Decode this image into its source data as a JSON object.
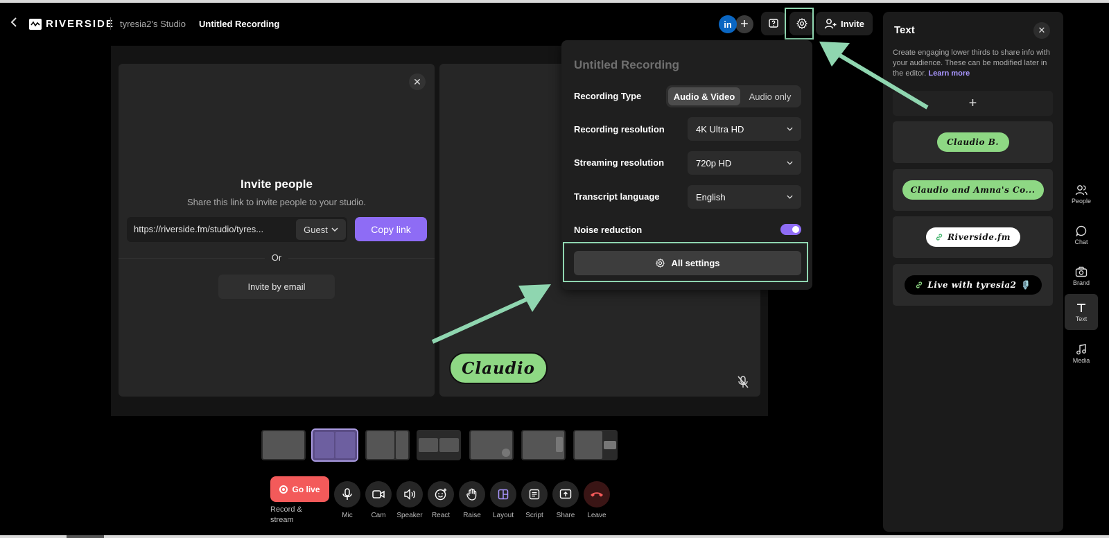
{
  "header": {
    "brand": "RIVERSIDE",
    "studio": "tyresia2's Studio",
    "recording_title": "Untitled Recording",
    "linkedin_badge": "in",
    "invite_label": "Invite"
  },
  "invite_card": {
    "title": "Invite people",
    "subtitle": "Share this link to invite people to your studio.",
    "link": "https://riverside.fm/studio/tyres...",
    "role": "Guest",
    "copy_label": "Copy link",
    "or_label": "Or",
    "email_label": "Invite by email"
  },
  "video": {
    "name_tag": "Claudio"
  },
  "settings": {
    "title": "Untitled Recording",
    "recording_type_label": "Recording Type",
    "recording_type_options": [
      "Audio & Video",
      "Audio only"
    ],
    "recording_type_selected": "Audio & Video",
    "recording_resolution_label": "Recording resolution",
    "recording_resolution_value": "4K Ultra HD",
    "streaming_resolution_label": "Streaming resolution",
    "streaming_resolution_value": "720p HD",
    "transcript_language_label": "Transcript language",
    "transcript_language_value": "English",
    "noise_reduction_label": "Noise reduction",
    "noise_reduction_on": true,
    "all_settings_label": "All settings"
  },
  "controls": {
    "golive_label": "Go live",
    "golive_sub": "Record & stream",
    "buttons": [
      {
        "label": "Mic",
        "icon": "mic-icon"
      },
      {
        "label": "Cam",
        "icon": "camera-icon"
      },
      {
        "label": "Speaker",
        "icon": "speaker-icon"
      },
      {
        "label": "React",
        "icon": "emoji-icon"
      },
      {
        "label": "Raise",
        "icon": "hand-icon"
      },
      {
        "label": "Layout",
        "icon": "layout-icon"
      },
      {
        "label": "Script",
        "icon": "script-icon"
      },
      {
        "label": "Share",
        "icon": "share-screen-icon"
      },
      {
        "label": "Leave",
        "icon": "phone-hangup-icon"
      }
    ]
  },
  "panel": {
    "title": "Text",
    "description": "Create engaging lower thirds to share info with your audience. These can be modified later in the editor.",
    "learn_more": "Learn more",
    "lower_thirds": [
      {
        "text": "Claudio B.",
        "style": "green"
      },
      {
        "text": "Claudio and Amna's Co...",
        "style": "green"
      },
      {
        "text": "Riverside.fm",
        "style": "white",
        "icon": "link-icon"
      },
      {
        "text": "Live with tyresia2 🎙️",
        "style": "black",
        "icon": "link-icon"
      }
    ]
  },
  "rail": [
    {
      "label": "People",
      "icon": "people-icon"
    },
    {
      "label": "Chat",
      "icon": "chat-icon"
    },
    {
      "label": "Brand",
      "icon": "brand-icon"
    },
    {
      "label": "Text",
      "icon": "text-icon",
      "active": true
    },
    {
      "label": "Media",
      "icon": "music-icon"
    }
  ],
  "colors": {
    "accent": "#8e6cf5",
    "golive": "#f35a5a",
    "highlight": "#8fd6b0",
    "tag_green": "#8ed884"
  }
}
